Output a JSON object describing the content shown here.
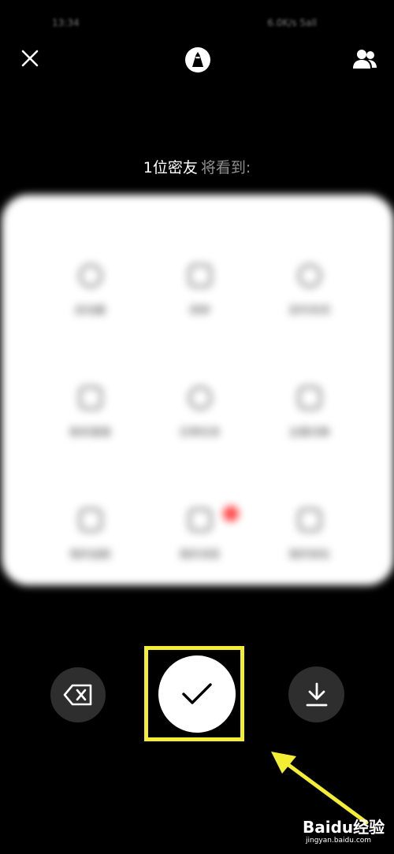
{
  "status_bar": {
    "time": "13:34",
    "network": "6.0K/s",
    "carrier": "5all"
  },
  "header": {
    "close_icon": "close-icon",
    "pen_icon": "pen-icon",
    "friends_icon": "friends-icon"
  },
  "audience": {
    "count_label": "1位密友",
    "suffix": "将看到:"
  },
  "preview": {
    "items": [
      {
        "label": "启动器",
        "icon": "compass-icon"
      },
      {
        "label": "闹钟",
        "icon": "alarm-icon"
      },
      {
        "label": "定时关闭",
        "icon": "timer-icon"
      },
      {
        "label": "联系客服",
        "icon": "edit-icon"
      },
      {
        "label": "日常任务",
        "icon": "pie-icon"
      },
      {
        "label": "主题切换",
        "icon": "shirt-icon"
      },
      {
        "label": "我的追剧",
        "icon": "bookmark-icon"
      },
      {
        "label": "我的消息",
        "icon": "mail-icon"
      },
      {
        "label": "我的钱包",
        "icon": "wallet-icon"
      }
    ],
    "badge_color": "#ff4a4a"
  },
  "actions": {
    "delete_icon": "backspace-icon",
    "confirm_icon": "check-icon",
    "download_icon": "download-icon"
  },
  "annotation": {
    "highlight_color": "#f3ee33",
    "arrow_color": "#f3ee33"
  },
  "watermark": {
    "brand": "Baidu经验",
    "site": "jingyan.baidu.com"
  }
}
